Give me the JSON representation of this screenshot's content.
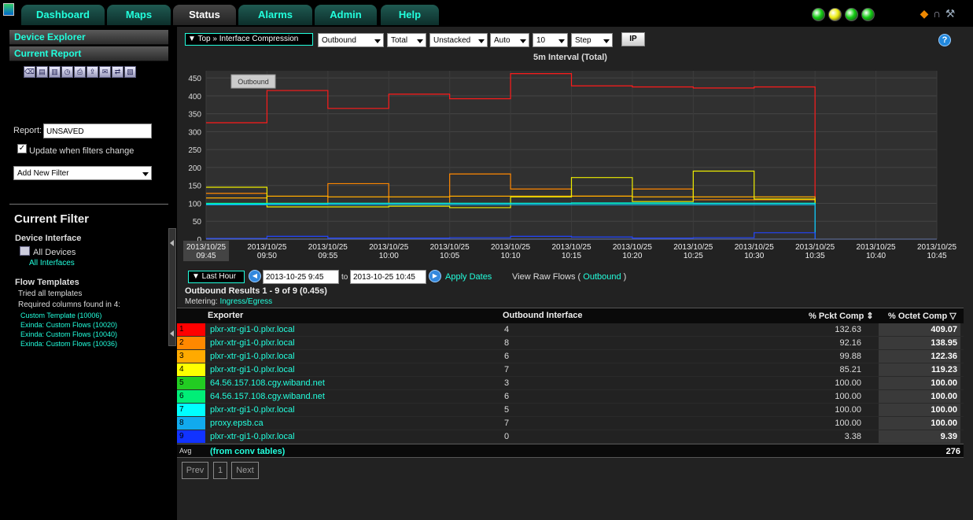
{
  "nav": {
    "tabs": [
      "Dashboard",
      "Maps",
      "Status",
      "Alarms",
      "Admin",
      "Help"
    ],
    "status_lights": [
      "#11cc11",
      "#eeee11",
      "#11cc11",
      "#11cc11"
    ]
  },
  "sidebar": {
    "device_explorer": "Device Explorer",
    "current_report": "Current Report",
    "report_label": "Report:",
    "report_value": "UNSAVED",
    "update_label": "Update when filters change",
    "add_filter": "Add New Filter",
    "current_filter_title": "Current Filter",
    "device_interface_title": "Device Interface",
    "all_devices": "All Devices",
    "all_interfaces": "All Interfaces",
    "flow_templates_title": "Flow Templates",
    "tried": "Tried all templates",
    "required": "Required columns found in 4:",
    "templates": [
      "Custom Template (10006)",
      "Exinda: Custom Flows (10020)",
      "Exinda: Custom Flows (10040)",
      "Exinda: Custom Flows (10036)"
    ]
  },
  "controls": {
    "report_title": "▼ Top » Interface Compression",
    "direction": "Outbound",
    "aggregation": "Total",
    "stacking": "Unstacked",
    "scale": "Auto",
    "count": "10",
    "line_mode": "Step",
    "ip_button": "IP"
  },
  "chart_data": {
    "type": "line",
    "title": "5m Interval (Total)",
    "legend_badge": "Outbound",
    "y_ticks": [
      0,
      50,
      100,
      150,
      200,
      250,
      300,
      350,
      400,
      450
    ],
    "ylim": [
      0,
      470
    ],
    "x_labels": [
      [
        "2013/10/25",
        "09:45"
      ],
      [
        "2013/10/25",
        "09:50"
      ],
      [
        "2013/10/25",
        "09:55"
      ],
      [
        "2013/10/25",
        "10:00"
      ],
      [
        "2013/10/25",
        "10:05"
      ],
      [
        "2013/10/25",
        "10:10"
      ],
      [
        "2013/10/25",
        "10:15"
      ],
      [
        "2013/10/25",
        "10:20"
      ],
      [
        "2013/10/25",
        "10:25"
      ],
      [
        "2013/10/25",
        "10:30"
      ],
      [
        "2013/10/25",
        "10:35"
      ],
      [
        "2013/10/25",
        "10:40"
      ],
      [
        "2013/10/25",
        "10:45"
      ]
    ],
    "series": [
      {
        "color": "#ff1a1a",
        "values": [
          325,
          415,
          365,
          405,
          392,
          462,
          428,
          425,
          422,
          425
        ]
      },
      {
        "color": "#ff8800",
        "values": [
          128,
          100,
          155,
          100,
          182,
          140,
          120,
          140,
          110,
          110
        ]
      },
      {
        "color": "#ffaa00",
        "values": [
          115,
          120,
          118,
          118,
          120,
          120,
          120,
          118,
          118,
          118
        ]
      },
      {
        "color": "#eeee00",
        "values": [
          145,
          90,
          90,
          92,
          88,
          118,
          172,
          105,
          190,
          112
        ]
      },
      {
        "color": "#33cc33",
        "values": [
          100,
          100,
          100,
          100,
          100,
          100,
          100,
          100,
          100,
          100
        ]
      },
      {
        "color": "#00ee88",
        "values": [
          100,
          100,
          100,
          100,
          100,
          100,
          100,
          100,
          100,
          100
        ]
      },
      {
        "color": "#00eeee",
        "values": [
          98,
          99,
          100,
          100,
          100,
          100,
          101,
          101,
          100,
          100
        ]
      },
      {
        "color": "#11aaee",
        "values": [
          96,
          96,
          96,
          96,
          96,
          96,
          96,
          96,
          96,
          96
        ]
      },
      {
        "color": "#2244ff",
        "values": [
          2,
          8,
          3,
          3,
          4,
          8,
          6,
          3,
          4,
          18
        ]
      }
    ]
  },
  "time_range": {
    "preset": "▼ Last Hour",
    "from": "2013-10-25 9:45",
    "to_label": "to",
    "to": "2013-10-25 10:45",
    "apply": "Apply Dates",
    "view_raw": "View Raw Flows (",
    "view_raw_link": "Outbound",
    "view_raw_end": ")"
  },
  "results": {
    "title": "Outbound Results 1 - 9 of 9 (0.45s)",
    "metering_label": "Metering:",
    "metering_value": "Ingress/Egress",
    "headers": {
      "exporter": "Exporter",
      "interface": "Outbound Interface",
      "pckt": "% Pckt Comp",
      "octet": "% Octet Comp"
    },
    "rows": [
      {
        "n": "1",
        "color": "#ff0000",
        "exporter": "plxr-xtr-gi1-0.plxr.local",
        "iface": "4",
        "pckt": "132.63",
        "octet": "409.07"
      },
      {
        "n": "2",
        "color": "#ff8800",
        "exporter": "plxr-xtr-gi1-0.plxr.local",
        "iface": "8",
        "pckt": "92.16",
        "octet": "138.95"
      },
      {
        "n": "3",
        "color": "#ffaa00",
        "exporter": "plxr-xtr-gi1-0.plxr.local",
        "iface": "6",
        "pckt": "99.88",
        "octet": "122.36"
      },
      {
        "n": "4",
        "color": "#ffff00",
        "exporter": "plxr-xtr-gi1-0.plxr.local",
        "iface": "7",
        "pckt": "85.21",
        "octet": "119.23"
      },
      {
        "n": "5",
        "color": "#22cc22",
        "exporter": "64.56.157.108.cgy.wiband.net",
        "iface": "3",
        "pckt": "100.00",
        "octet": "100.00"
      },
      {
        "n": "6",
        "color": "#00ee77",
        "exporter": "64.56.157.108.cgy.wiband.net",
        "iface": "6",
        "pckt": "100.00",
        "octet": "100.00"
      },
      {
        "n": "7",
        "color": "#00ffff",
        "exporter": "plxr-xtr-gi1-0.plxr.local",
        "iface": "5",
        "pckt": "100.00",
        "octet": "100.00"
      },
      {
        "n": "8",
        "color": "#11aaee",
        "exporter": "proxy.epsb.ca",
        "iface": "7",
        "pckt": "100.00",
        "octet": "100.00"
      },
      {
        "n": "9",
        "color": "#1133ff",
        "exporter": "plxr-xtr-gi1-0.plxr.local",
        "iface": "0",
        "pckt": "3.38",
        "octet": "9.39"
      }
    ],
    "avg_label": "Avg",
    "avg_note": "(from conv tables)",
    "avg_value": "276"
  },
  "pagination": {
    "prev": "Prev",
    "page": "1",
    "next": "Next"
  }
}
